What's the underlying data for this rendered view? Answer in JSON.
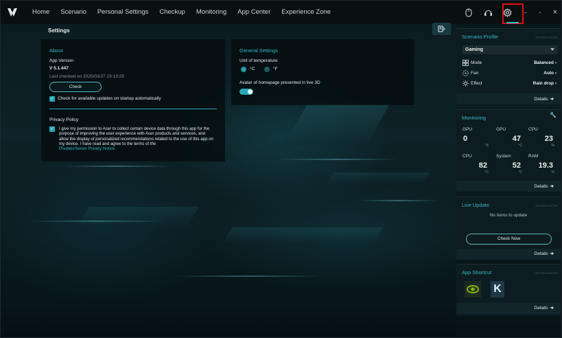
{
  "nav": {
    "items": [
      "Home",
      "Scenario",
      "Personal Settings",
      "Checkup",
      "Monitoring",
      "App Center",
      "Experience Zone"
    ]
  },
  "window": {
    "minimize": "–",
    "maximize": "▫",
    "close": "×"
  },
  "page_title": "Settings",
  "about": {
    "heading": "About",
    "app_version_label": "App Version",
    "app_version": "V 5.1.447",
    "last_checked": "Last checked on 2025/03/27 23:13:29",
    "check_button": "Check",
    "auto_check_label": "Check for available updates on startup automatically",
    "privacy_heading": "Privacy Policy",
    "privacy_text": "I give my permission to Acer to collect certain device data through this app for the purpose of improving the user experience with Acer products and services, and allow the display of personalized recommendations related to the use of this app on my device. I have read and agree to the terms of the",
    "privacy_link": "PredatorSense Privacy Notice"
  },
  "general": {
    "heading": "General Settings",
    "temp_label": "Unit of temperature",
    "celsius": "°C",
    "fahrenheit": "°F",
    "avatar_label": "Avatar of homepage presented in live 3D"
  },
  "scenario": {
    "heading": "Scenario Profile",
    "selected": "Gaming",
    "rows": [
      {
        "label": "Mode",
        "value": "Balanced"
      },
      {
        "label": "Fan",
        "value": "Auto"
      },
      {
        "label": "Effect",
        "value": "Rain drop"
      }
    ],
    "details": "Details"
  },
  "monitoring": {
    "heading": "Monitoring",
    "tiles": [
      {
        "name": "GPU",
        "value": "0",
        "unit": "%"
      },
      {
        "name": "GPU",
        "value": "47",
        "unit": "°C"
      },
      {
        "name": "CPU",
        "value": "23",
        "unit": "%"
      },
      {
        "name": "CPU",
        "value": "82",
        "unit": "°C"
      },
      {
        "name": "System",
        "value": "52",
        "unit": "°C"
      },
      {
        "name": "RAM",
        "value": "19.3",
        "unit": "%"
      }
    ],
    "details": "Details"
  },
  "live_update": {
    "heading": "Live Update",
    "empty": "No items to update",
    "check_now": "Check Now",
    "details": "Details"
  },
  "shortcut": {
    "heading": "App Shortcut",
    "details": "Details",
    "apps": [
      "nvidia-icon",
      "k-app-icon"
    ]
  },
  "colors": {
    "accent": "#2aa6b6",
    "highlight": "#e01010"
  }
}
